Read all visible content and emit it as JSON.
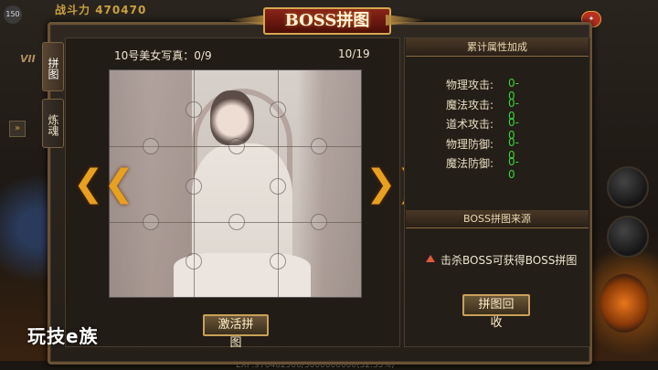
{
  "hud": {
    "power_label": "战斗力",
    "power_value": "470470",
    "level": "150",
    "vip": "VII",
    "exp_text": "EXP:970462500/3000000000(32.35%)",
    "watermark": "玩技e族"
  },
  "window": {
    "title": "BOSS拼图"
  },
  "tabs": [
    {
      "label": "拼图"
    },
    {
      "label": "炼魂"
    }
  ],
  "puzzle": {
    "name": "10号美女写真：0/9",
    "page": "10/19",
    "activate_label": "激活拼图",
    "prev_arrow": "❮❮",
    "next_arrow": "❯❯"
  },
  "attributes": {
    "header": "累计属性加成",
    "rows": [
      {
        "label": "物理攻击:",
        "value": "0-0"
      },
      {
        "label": "魔法攻击:",
        "value": "0-0"
      },
      {
        "label": "道术攻击:",
        "value": "0-0"
      },
      {
        "label": "物理防御:",
        "value": "0-0"
      },
      {
        "label": "魔法防御:",
        "value": "0-0"
      }
    ]
  },
  "source": {
    "header": "BOSS拼图来源",
    "text": "击杀BOSS可获得BOSS拼图",
    "recycle_label": "拼图回收"
  }
}
